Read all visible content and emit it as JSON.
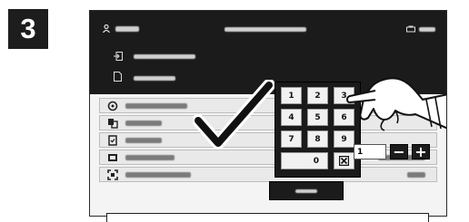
{
  "step": {
    "number": "3"
  },
  "keypad": {
    "keys": [
      "1",
      "2",
      "3",
      "4",
      "5",
      "6",
      "7",
      "8",
      "9",
      "0"
    ]
  },
  "quantity": {
    "value": "1",
    "decrement": "−",
    "increment": "+"
  },
  "colors": {
    "header_bg": "#1b1b1b",
    "screen_bg": "#f4f4f4",
    "keypad_bg": "#1a1a1a",
    "row_bg": "#e9e9e9"
  },
  "icons": {
    "header": [
      "user-icon",
      "printer-icon"
    ],
    "menu": [
      "import-icon",
      "document-icon"
    ],
    "rows": [
      "color-icon",
      "sides-icon",
      "copy-icon",
      "layout-icon",
      "scan-icon"
    ],
    "overlay": [
      "checkmark-icon",
      "hand-pointer-icon",
      "clear-icon"
    ]
  }
}
